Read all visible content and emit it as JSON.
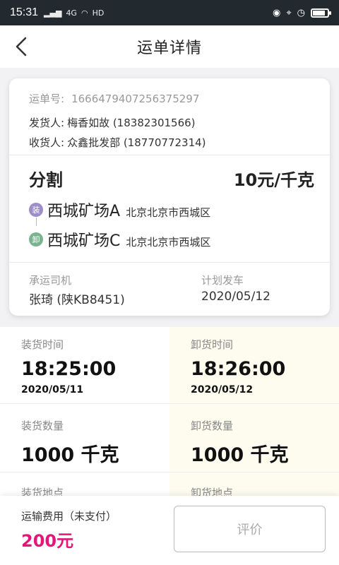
{
  "status_bar": {
    "time": "15:31",
    "signal_text": "4G",
    "hd_text": "HD",
    "battery_level": 0.85
  },
  "navbar": {
    "title": "运单详情",
    "back_icon": "chevron-left-icon"
  },
  "order": {
    "no_label": "运单号:",
    "no_value": "1666479407256375297",
    "sender_label": "发货人:",
    "sender_value": "梅香如故 (18382301566)",
    "receiver_label": "收货人:",
    "receiver_value": "众鑫批发部 (18770772314)",
    "cargo": "分割",
    "price": "10元/千克",
    "load_badge": "装",
    "load_name": "西城矿场A",
    "load_addr": "北京北京市西城区",
    "unload_badge": "卸",
    "unload_name": "西城矿场C",
    "unload_addr": "北京北京市西城区",
    "driver_label": "承运司机",
    "driver_value": "张琦 (陕KB8451)",
    "depart_label": "计划发车",
    "depart_value": "2020/05/12"
  },
  "details": {
    "load_time_label": "装货时间",
    "load_time": "18:25:00",
    "load_date": "2020/05/11",
    "unload_time_label": "卸货时间",
    "unload_time": "18:26:00",
    "unload_date": "2020/05/12",
    "load_qty_label": "装货数量",
    "load_qty": "1000 千克",
    "unload_qty_label": "卸货数量",
    "unload_qty": "1000 千克",
    "load_place_label": "装货地点",
    "unload_place_label": "卸货地点"
  },
  "footer": {
    "fee_label": "运输费用（未支付）",
    "fee_value": "200元",
    "rate_button": "评价"
  },
  "colors": {
    "status_bar": "#222a30",
    "accent_fee": "#e3167a",
    "load_badge": "#9b8ec9",
    "unload_badge": "#7ab48e",
    "unload_column_bg": "#fdfcef"
  }
}
